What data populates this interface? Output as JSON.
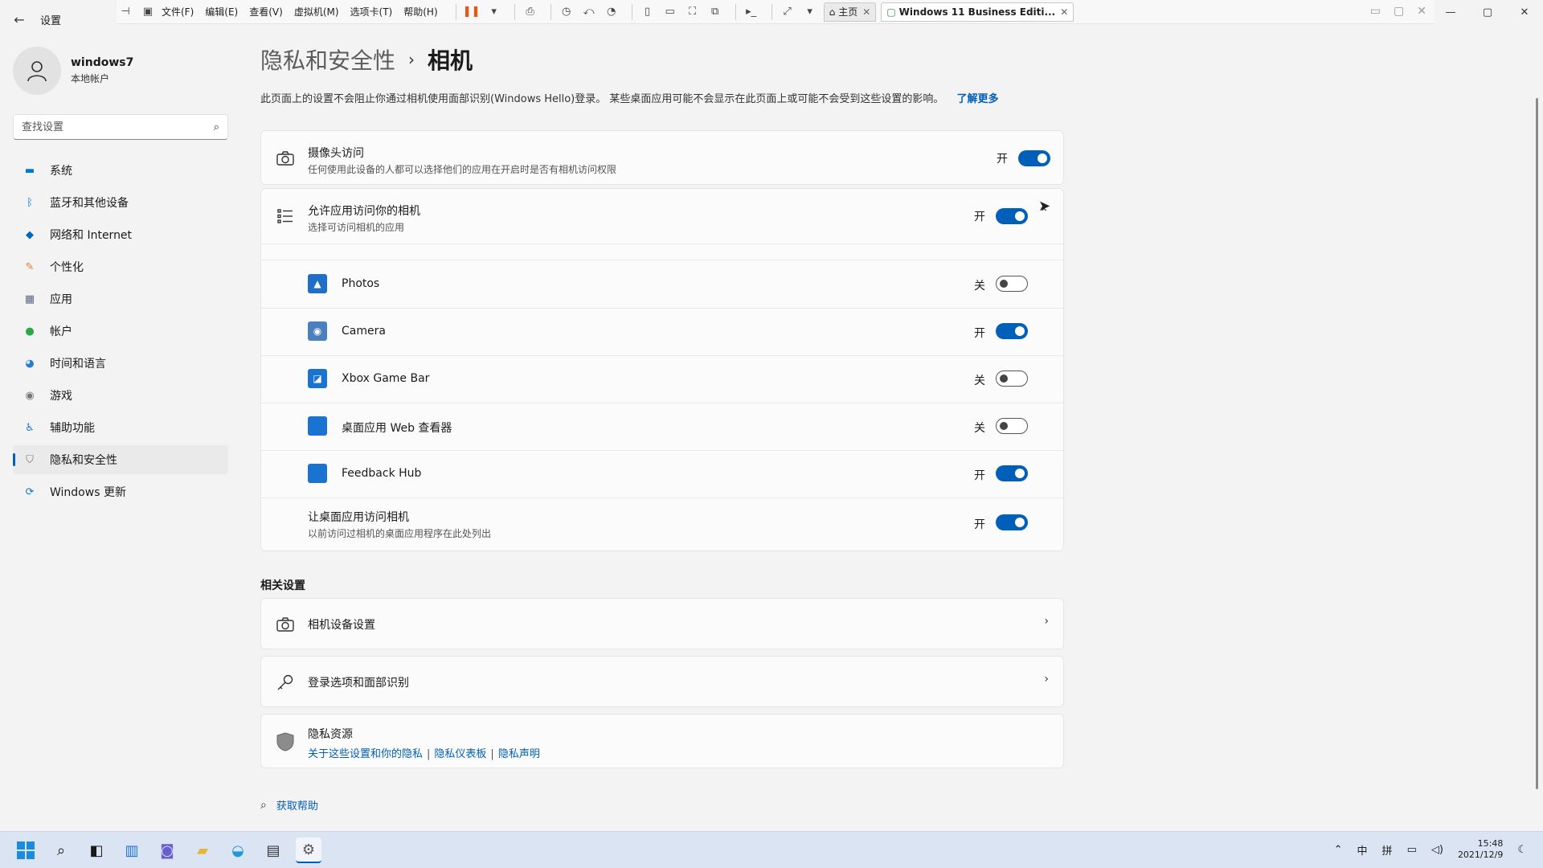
{
  "window": {
    "title": "设置",
    "back": "←"
  },
  "vm_toolbar": {
    "menus": [
      "文件(F)",
      "编辑(E)",
      "查看(V)",
      "虚拟机(M)",
      "选项卡(T)",
      "帮助(H)"
    ],
    "tabs": [
      {
        "label": "主页"
      },
      {
        "label": "Windows 11 Business Editi..."
      }
    ]
  },
  "user": {
    "name": "windows7",
    "subtitle": "本地帐户"
  },
  "search": {
    "placeholder": "查找设置"
  },
  "sidebar": {
    "items": [
      {
        "label": "系统",
        "icon": "display-icon",
        "color": "#0078d4"
      },
      {
        "label": "蓝牙和其他设备",
        "icon": "bluetooth-icon",
        "color": "#0078d4"
      },
      {
        "label": "网络和 Internet",
        "icon": "wifi-icon",
        "color": "#0067c0"
      },
      {
        "label": "个性化",
        "icon": "brush-icon",
        "color": "#e07b39"
      },
      {
        "label": "应用",
        "icon": "apps-icon",
        "color": "#5a6b7f"
      },
      {
        "label": "帐户",
        "icon": "person-icon",
        "color": "#2aa84a"
      },
      {
        "label": "时间和语言",
        "icon": "globe-clock-icon",
        "color": "#2b7bd6"
      },
      {
        "label": "游戏",
        "icon": "gamepad-icon",
        "color": "#777777"
      },
      {
        "label": "辅助功能",
        "icon": "accessibility-icon",
        "color": "#1a73d0"
      },
      {
        "label": "隐私和安全性",
        "icon": "shield-icon",
        "color": "#777777",
        "active": true
      },
      {
        "label": "Windows 更新",
        "icon": "update-icon",
        "color": "#0a74c8"
      }
    ]
  },
  "main": {
    "breadcrumb_parent": "隐私和安全性",
    "breadcrumb_sep": "›",
    "breadcrumb_current": "相机",
    "description": "此页面上的设置不会阻止你通过相机使用面部识别(Windows Hello)登录。 某些桌面应用可能不会显示在此页面上或可能不会受到这些设置的影响。",
    "learn_more": "了解更多",
    "camera_access": {
      "title": "摄像头访问",
      "subtitle": "任何使用此设备的人都可以选择他们的应用在开启时是否有相机访问权限",
      "state": "开"
    },
    "app_access": {
      "title": "允许应用访问你的相机",
      "subtitle": "选择可访问相机的应用",
      "state": "开"
    },
    "apps": [
      {
        "name": "Photos",
        "state": "关",
        "on": false
      },
      {
        "name": "Camera",
        "state": "开",
        "on": true
      },
      {
        "name": "Xbox Game Bar",
        "state": "关",
        "on": false
      },
      {
        "name": "桌面应用 Web 查看器",
        "state": "关",
        "on": false
      },
      {
        "name": "Feedback Hub",
        "state": "开",
        "on": true
      }
    ],
    "desktop_access": {
      "title": "让桌面应用访问相机",
      "subtitle": "以前访问过相机的桌面应用程序在此处列出",
      "state": "开"
    },
    "related_title": "相关设置",
    "related": [
      {
        "title": "相机设备设置"
      },
      {
        "title": "登录选项和面部识别"
      }
    ],
    "privacy_resources": {
      "title": "隐私资源",
      "links": [
        "关于这些设置和你的隐私",
        "隐私仪表板",
        "隐私声明"
      ]
    },
    "help": "获取帮助"
  },
  "taskbar": {
    "tray": {
      "ime1": "中",
      "ime2": "拼",
      "time": "15:48",
      "date": "2021/12/9"
    }
  }
}
